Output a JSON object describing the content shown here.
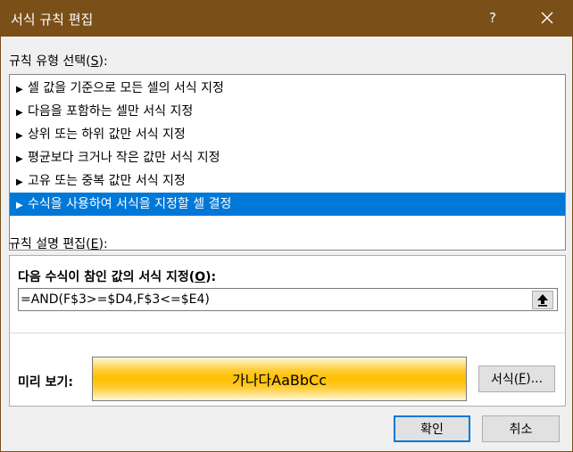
{
  "window": {
    "title": "서식 규칙 편집",
    "help_label": "?"
  },
  "rule_type": {
    "label": "규칙 유형 선택(",
    "access_key": "S",
    "label_tail": "):",
    "items": [
      {
        "label": "셀 값을 기준으로 모든 셀의 서식 지정",
        "selected": false
      },
      {
        "label": "다음을 포함하는 셀만 서식 지정",
        "selected": false
      },
      {
        "label": "상위 또는 하위 값만 서식 지정",
        "selected": false
      },
      {
        "label": "평균보다 크거나 작은 값만 서식 지정",
        "selected": false
      },
      {
        "label": "고유 또는 중복 값만 서식 지정",
        "selected": false
      },
      {
        "label": "수식을 사용하여 서식을 지정할 셀 결정",
        "selected": true
      }
    ]
  },
  "rule_desc": {
    "label": "규칙 설명 편집(",
    "access_key": "E",
    "label_tail": "):",
    "formula_title": "다음 수식이 참인 값의 서식 지정(",
    "formula_access_key": "O",
    "formula_title_tail": "):",
    "formula_value": "=AND(F$3>=$D4,F$3<=$E4)",
    "preview_label": "미리 보기:",
    "preview_text": "가나다AaBbCc",
    "format_button": "서식(",
    "format_access_key": "F",
    "format_button_tail": ")..."
  },
  "buttons": {
    "ok": "확인",
    "cancel": "취소"
  },
  "colors": {
    "titlebar": "#7a4f18",
    "selection": "#0078d7",
    "preview_fill": "#ffc000"
  }
}
